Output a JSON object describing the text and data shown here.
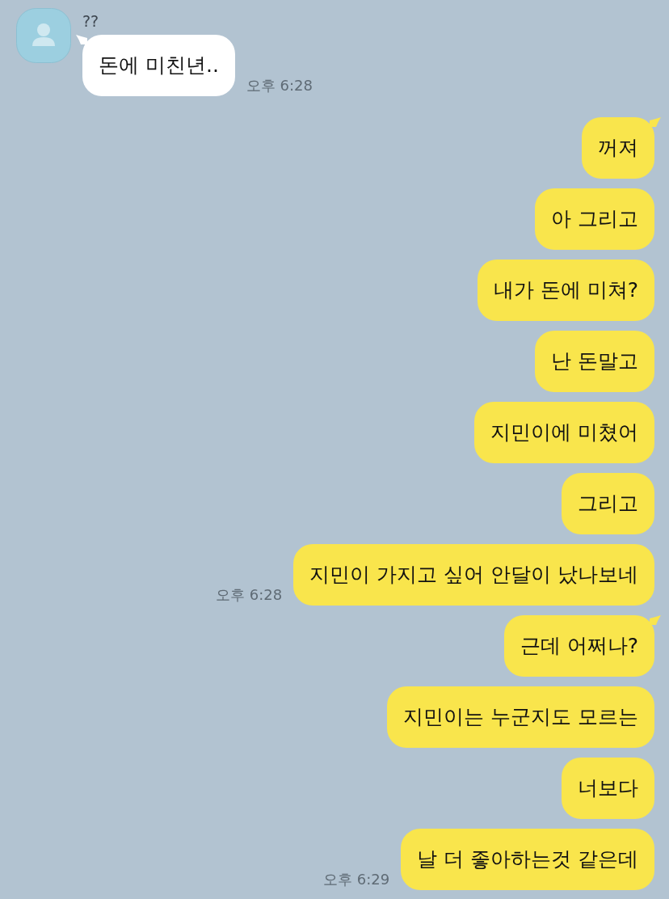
{
  "incoming": {
    "sender": "??",
    "messages": [
      {
        "text": "돈에 미친년..",
        "tail": true,
        "time": "오후 6:28"
      }
    ]
  },
  "outgoing": {
    "messages": [
      {
        "text": "꺼져",
        "tail": true
      },
      {
        "text": "아 그리고",
        "tail": false
      },
      {
        "text": "내가 돈에 미쳐?",
        "tail": false
      },
      {
        "text": "난 돈말고",
        "tail": false
      },
      {
        "text": "지민이에 미쳤어",
        "tail": false
      },
      {
        "text": "그리고",
        "tail": false
      },
      {
        "text": "지민이 가지고 싶어 안달이 났나보네",
        "tail": false,
        "time": "오후 6:28"
      },
      {
        "text": "근데 어쩌나?",
        "tail": true
      },
      {
        "text": "지민이는 누군지도 모르는",
        "tail": false
      },
      {
        "text": "너보다",
        "tail": false
      },
      {
        "text": "날 더 좋아하는것 같은데",
        "tail": false,
        "time": "오후 6:29"
      }
    ]
  }
}
